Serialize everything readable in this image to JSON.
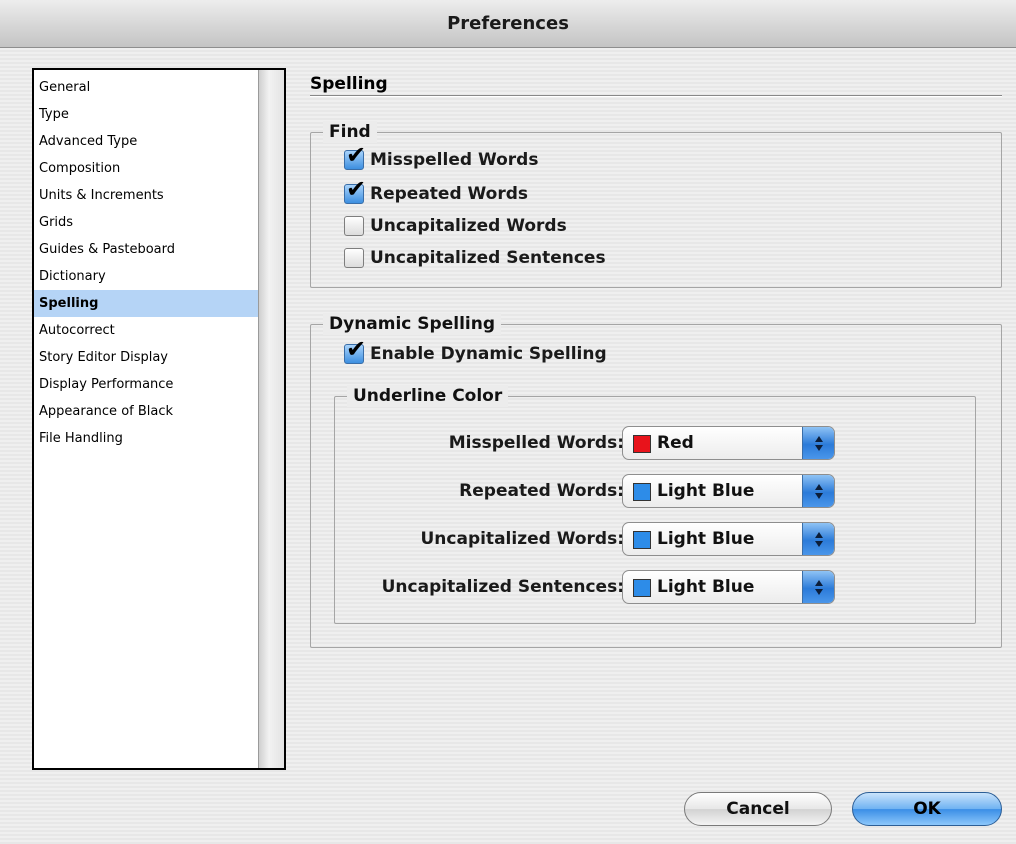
{
  "window": {
    "title": "Preferences"
  },
  "sidebar": {
    "items": [
      {
        "label": "General"
      },
      {
        "label": "Type"
      },
      {
        "label": "Advanced Type"
      },
      {
        "label": "Composition"
      },
      {
        "label": "Units & Increments"
      },
      {
        "label": "Grids"
      },
      {
        "label": "Guides & Pasteboard"
      },
      {
        "label": "Dictionary"
      },
      {
        "label": "Spelling",
        "selected": true
      },
      {
        "label": "Autocorrect"
      },
      {
        "label": "Story Editor Display"
      },
      {
        "label": "Display Performance"
      },
      {
        "label": "Appearance of Black"
      },
      {
        "label": "File Handling"
      }
    ]
  },
  "panel": {
    "title": "Spelling"
  },
  "find": {
    "legend": "Find",
    "options": [
      {
        "label": "Misspelled Words",
        "checked": true
      },
      {
        "label": "Repeated Words",
        "checked": true
      },
      {
        "label": "Uncapitalized Words",
        "checked": false
      },
      {
        "label": "Uncapitalized Sentences",
        "checked": false
      }
    ]
  },
  "dynamic": {
    "legend": "Dynamic Spelling",
    "enable": {
      "label": "Enable Dynamic Spelling",
      "checked": true
    },
    "underline": {
      "legend": "Underline Color",
      "rows": [
        {
          "label": "Misspelled Words:",
          "value": "Red",
          "swatch": "#e8131b"
        },
        {
          "label": "Repeated Words:",
          "value": "Light Blue",
          "swatch": "#2d8ce8"
        },
        {
          "label": "Uncapitalized Words:",
          "value": "Light Blue",
          "swatch": "#2d8ce8"
        },
        {
          "label": "Uncapitalized Sentences:",
          "value": "Light Blue",
          "swatch": "#2d8ce8"
        }
      ]
    }
  },
  "buttons": {
    "cancel": "Cancel",
    "ok": "OK"
  },
  "icons": {
    "checkmark": "✔"
  }
}
